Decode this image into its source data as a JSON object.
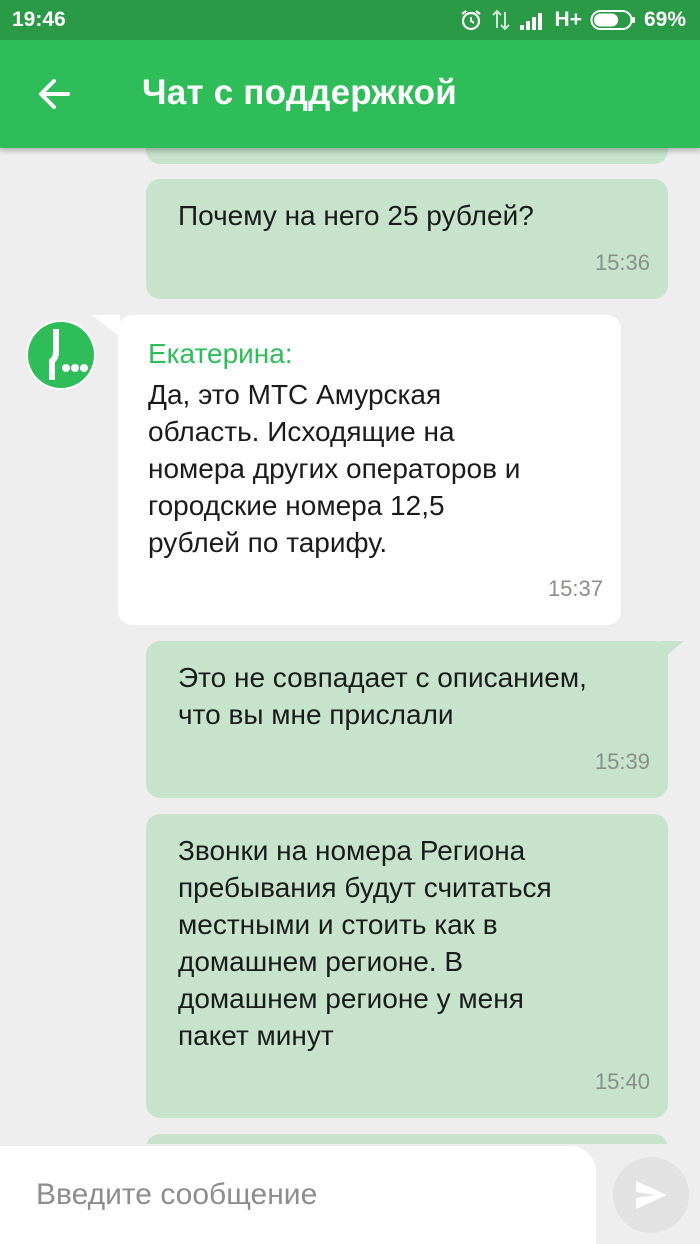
{
  "status_bar": {
    "time": "19:46",
    "network": "H+",
    "battery_text": "69%",
    "battery_level": 0.69
  },
  "app_bar": {
    "title": "Чат с поддержкой",
    "back_icon": "arrow-left-icon"
  },
  "messages": [
    {
      "direction": "out",
      "text": "Почему на него 25 рублей?",
      "time": "15:36"
    },
    {
      "direction": "in",
      "sender": "Екатерина:",
      "text": "Да, это МТС Амурская\nобласть. Исходящие на\nномера других операторов и\nгородские номера 12,5\nрублей по тарифу.",
      "time": "15:37"
    },
    {
      "direction": "out",
      "text": "Это не совпадает с описанием,\nчто вы мне прислали",
      "time": "15:39"
    },
    {
      "direction": "out",
      "text": "Звонки на номера Региона\nпребывания будут считаться\nместными и стоить как в\nдомашнем регионе. В\nдомашнем регионе у меня\nпакет минут",
      "time": "15:40"
    }
  ],
  "composer": {
    "placeholder": "Введите сообщение",
    "value": "",
    "send_icon": "send-icon"
  },
  "colors": {
    "status_bar": "#2a9a46",
    "app_bar": "#2ebd59",
    "outgoing_bubble": "#c7e3cc",
    "incoming_bubble": "#ffffff",
    "sender_name": "#2ebd59"
  }
}
